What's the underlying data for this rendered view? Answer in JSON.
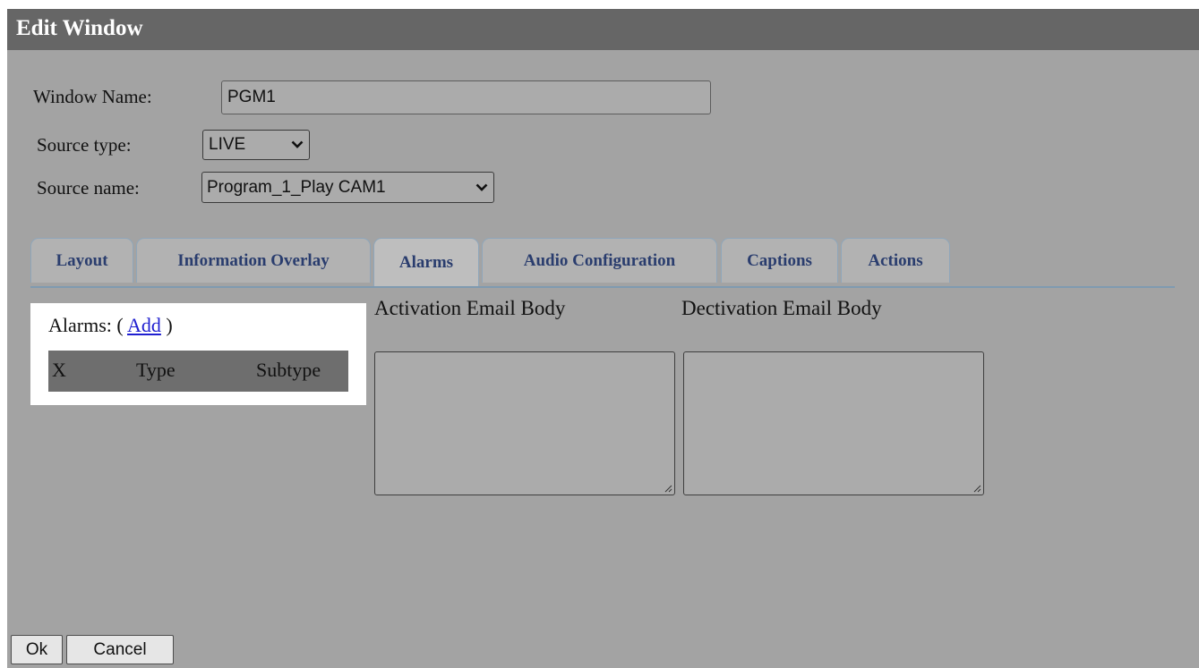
{
  "dialog": {
    "title": "Edit Window"
  },
  "form": {
    "window_name_label": "Window Name:",
    "window_name_value": "PGM1",
    "source_type_label": "Source type:",
    "source_type_value": "LIVE",
    "source_name_label": "Source name:",
    "source_name_value": "Program_1_Play CAM1"
  },
  "tabs": [
    {
      "label": "Layout",
      "active": false
    },
    {
      "label": "Information Overlay",
      "active": false
    },
    {
      "label": "Alarms",
      "active": true
    },
    {
      "label": "Audio Configuration",
      "active": false
    },
    {
      "label": "Captions",
      "active": false
    },
    {
      "label": "Actions",
      "active": false
    }
  ],
  "alarms": {
    "label": "Alarms: (",
    "add_link": "Add",
    "close_paren": ")",
    "columns": [
      "X",
      "Type",
      "Subtype"
    ]
  },
  "email": {
    "activation_label": "Activation Email Body",
    "activation_value": "",
    "deactivation_label": "Dectivation Email Body",
    "deactivation_value": ""
  },
  "buttons": {
    "ok": "Ok",
    "cancel": "Cancel"
  },
  "colors": {
    "titlebar": "#666666",
    "dialog_bg": "#a3a3a3",
    "tab_text": "#2a3d6e",
    "link": "#1f1fd0"
  },
  "icons": {
    "select_arrow": "chevron-down-icon",
    "textarea_grip": "resize-grip-icon"
  }
}
